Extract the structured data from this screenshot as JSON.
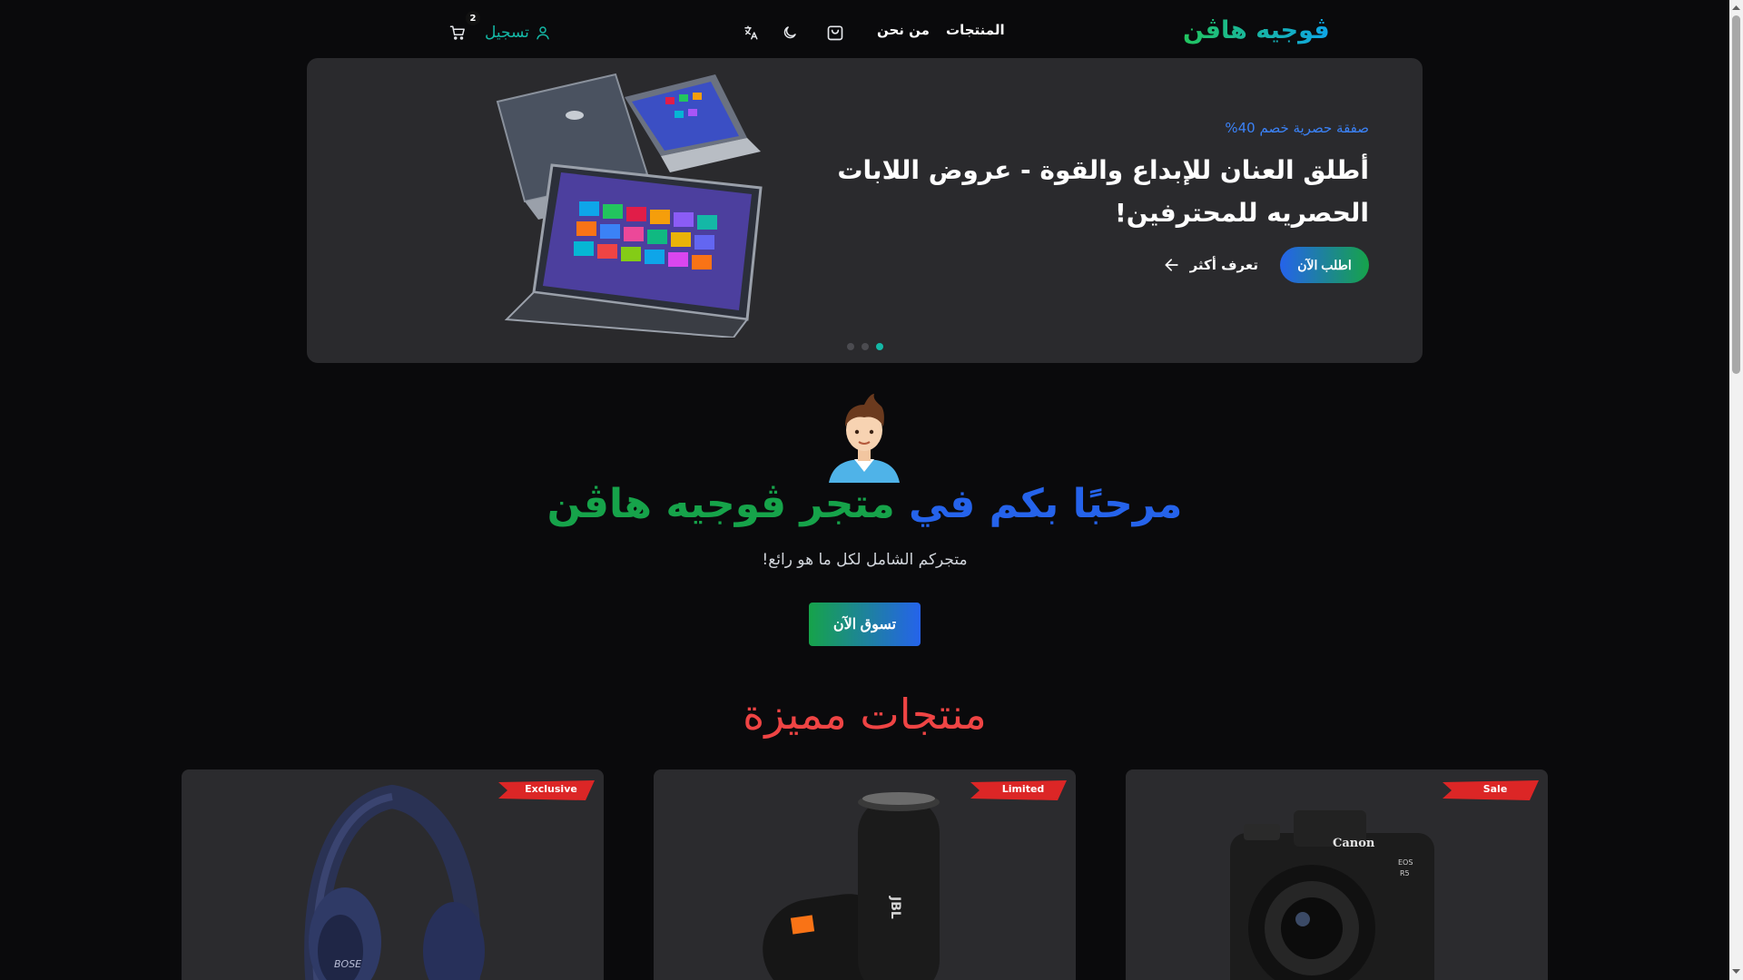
{
  "header": {
    "brand": "ڤوجيه هاڤن",
    "nav": {
      "products": "المنتجات",
      "about": "من نحن"
    },
    "login_label": "تسجيل",
    "cart_count": "2",
    "icons": [
      "shopping-bag-icon",
      "moon-icon",
      "translate-icon",
      "user-icon",
      "cart-icon"
    ]
  },
  "hero": {
    "kicker": "صفقة حصرية خصم 40%",
    "title": "أطلق العنان للإبداع والقوة - عروض اللابات الحصريه للمحترفين!",
    "order_button": "اطلب الآن",
    "learn_more": "تعرف أكثر",
    "slides": 3,
    "active_slide": 1
  },
  "welcome": {
    "part_blue": "مرحبًا بكم في",
    "part_green": "متجر ڤوجيه هاڤن",
    "subtitle": "متجركم الشامل لكل ما هو رائع!",
    "shop_button": "تسوق الآن"
  },
  "featured": {
    "title": "منتجات مميزة",
    "products": [
      {
        "badge": "Exclusive",
        "product": "headphones"
      },
      {
        "badge": "Limited",
        "product": "speaker"
      },
      {
        "badge": "Sale",
        "product": "camera"
      }
    ]
  },
  "colors": {
    "background": "#0a0a0c",
    "card": "#2b2b2e",
    "accent_teal": "#14b8a6",
    "accent_blue": "#2563eb",
    "accent_green": "#16a34a",
    "ribbon_red": "#dc2626",
    "featured_title": "#ef4444"
  }
}
